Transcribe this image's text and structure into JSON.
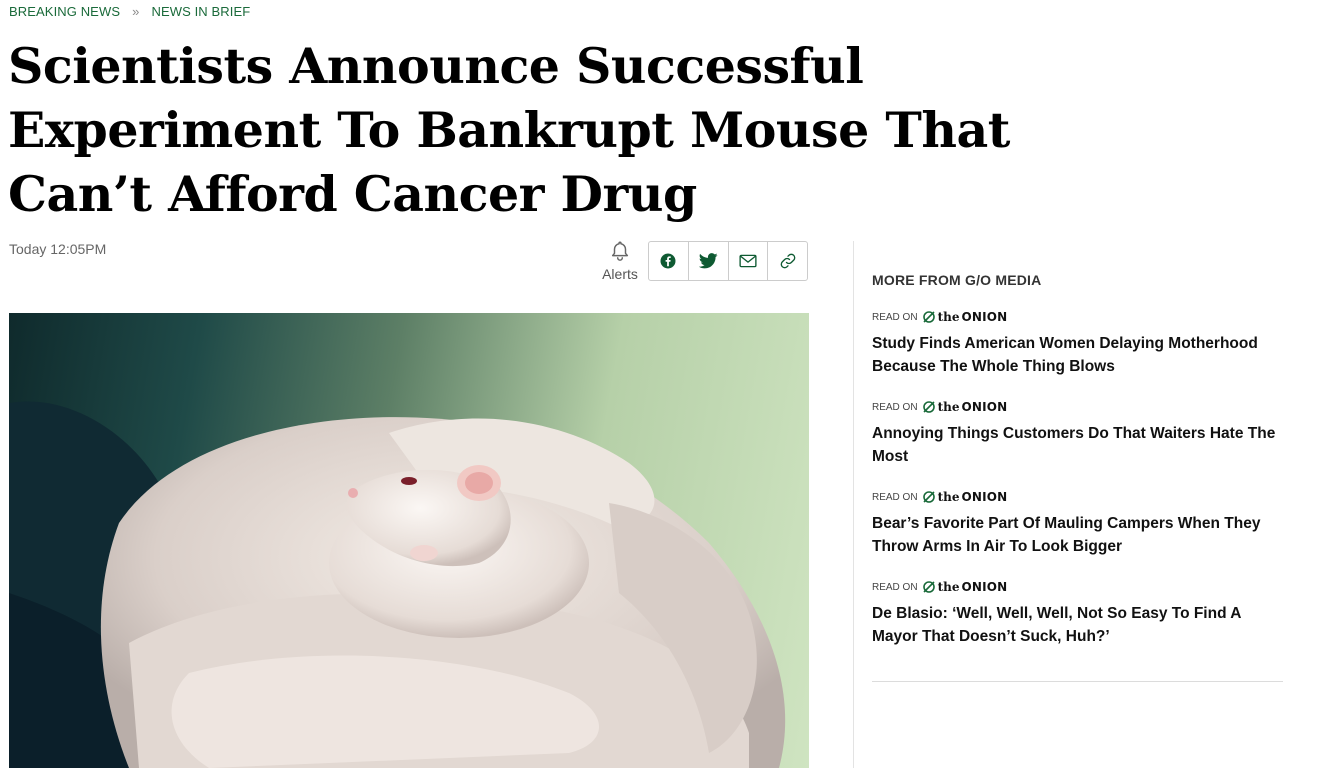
{
  "breadcrumb": {
    "items": [
      "BREAKING NEWS",
      "NEWS IN BRIEF"
    ],
    "separator": "»"
  },
  "article": {
    "headline_lines": [
      "Scientists Announce Successful",
      "Experiment To Bankrupt Mouse That",
      "Can’t Afford Cancer Drug"
    ],
    "timestamp": "Today 12:05PM"
  },
  "toolbar": {
    "alerts_label": "Alerts",
    "share_icons": [
      "facebook-icon",
      "twitter-icon",
      "email-icon",
      "link-icon"
    ]
  },
  "sidebar": {
    "title": "MORE FROM G/O MEDIA",
    "read_on_label": "READ ON",
    "brand": {
      "the": "the",
      "name": "ONION"
    },
    "stories": [
      "Study Finds American Women Delaying Motherhood Because The Whole Thing Blows",
      "Annoying Things Customers Do That Waiters Hate The Most",
      "Bear’s Favorite Part Of Mauling Campers When They Throw Arms In Air To Look Bigger",
      "De Blasio: ‘Well, Well, Well, Not So Easy To Find A Mayor That Doesn’t Suck, Huh?’"
    ]
  },
  "colors": {
    "accent_green": "#1a6a3a",
    "share_icon": "#0e5a32",
    "text": "#111111"
  }
}
